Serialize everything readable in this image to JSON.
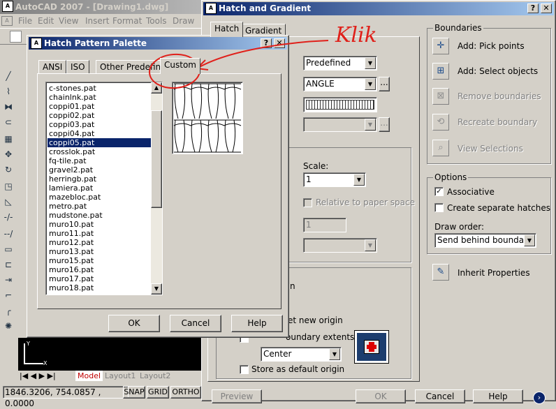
{
  "autocad": {
    "title": "AutoCAD 2007 - [Drawing1.dwg]",
    "menu": [
      "File",
      "Edit",
      "View",
      "Insert",
      "Format",
      "Tools",
      "Draw"
    ],
    "layout_tabs": [
      "Model",
      "Layout1",
      "Layout2"
    ],
    "coords": "1846.3206, 754.0857 , 0.0000",
    "status_buttons": [
      "SNAP",
      "GRID",
      "ORTHO"
    ],
    "ucs_x": "X",
    "ucs_y": "Y"
  },
  "hatch_dialog": {
    "title": "Hatch and Gradient",
    "tabs": [
      "Hatch",
      "Gradient"
    ],
    "type_value": "Predefined",
    "pattern_value": "ANGLE",
    "scale_label": "Scale:",
    "scale_value": "1",
    "relative_label": "Relative to paper space",
    "spacing_value": "1",
    "new_origin_label": "et new origin",
    "boundary_extents_label": "oundary extents",
    "origin_letter": "n",
    "origin_position": "Center",
    "store_default_label": "Store as default origin",
    "bottom_buttons": [
      "Preview",
      "OK",
      "Cancel",
      "Help"
    ],
    "boundaries": {
      "title": "Boundaries",
      "items": [
        {
          "label": "Add: Pick points",
          "icon": "pick-points-icon",
          "enabled": true
        },
        {
          "label": "Add: Select objects",
          "icon": "select-objects-icon",
          "enabled": true
        },
        {
          "label": "Remove boundaries",
          "icon": "remove-boundaries-icon",
          "enabled": false
        },
        {
          "label": "Recreate boundary",
          "icon": "recreate-boundary-icon",
          "enabled": false
        },
        {
          "label": "View Selections",
          "icon": "view-selections-icon",
          "enabled": false
        }
      ]
    },
    "options": {
      "title": "Options",
      "associative_label": "Associative",
      "associative_checked": true,
      "separate_label": "Create separate hatches",
      "separate_checked": false,
      "draw_order_label": "Draw order:",
      "draw_order_value": "Send behind boundary"
    },
    "inherit_label": "Inherit Properties"
  },
  "palette": {
    "title": "Hatch Pattern Palette",
    "tabs": [
      "ANSI",
      "ISO",
      "Other Predefined",
      "Custom"
    ],
    "active_tab": "Custom",
    "patterns": [
      "c-stones.pat",
      "chainlnk.pat",
      "coppi01.pat",
      "coppi02.pat",
      "coppi03.pat",
      "coppi04.pat",
      "coppi05.pat",
      "crosslok.pat",
      "fq-tile.pat",
      "gravel2.pat",
      "herringb.pat",
      "lamiera.pat",
      "mazebloc.pat",
      "metro.pat",
      "mudstone.pat",
      "muro10.pat",
      "muro11.pat",
      "muro12.pat",
      "muro13.pat",
      "muro15.pat",
      "muro16.pat",
      "muro17.pat",
      "muro18.pat"
    ],
    "selected": "coppi05.pat",
    "buttons": [
      "OK",
      "Cancel",
      "Help"
    ]
  },
  "annotation": {
    "text": "Klik",
    "color": "#e0201a"
  }
}
